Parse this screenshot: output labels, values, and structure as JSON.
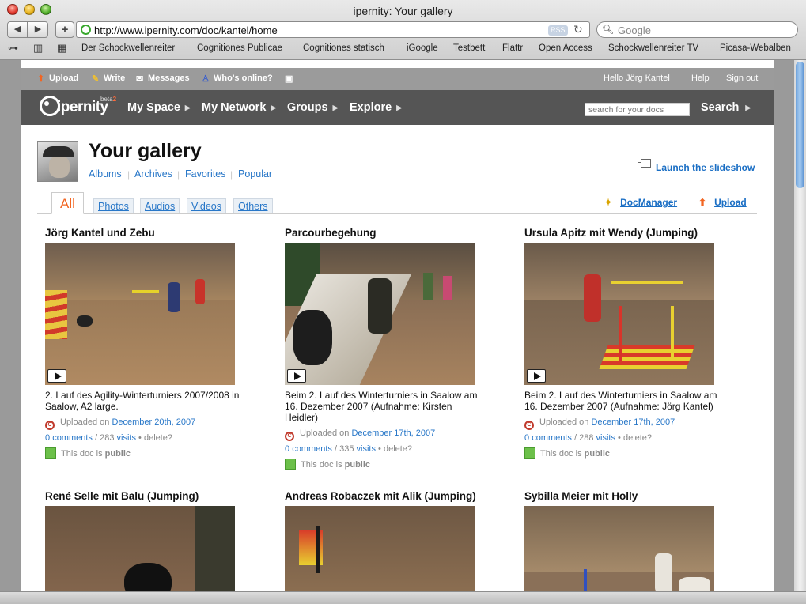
{
  "browser": {
    "window_title": "ipernity: Your gallery",
    "url": "http://www.ipernity.com/doc/kantel/home",
    "rss_label": "RSS",
    "search_placeholder": "Google",
    "bookmarks": [
      "Der Schockwellenreiter",
      "Cognitiones Publicae",
      "Cognitiones statisch",
      "iGoogle",
      "Testbett",
      "Flattr",
      "Open Access",
      "Schockwellenreiter TV",
      "Picasa-Webalben"
    ]
  },
  "topbar": {
    "upload": "Upload",
    "write": "Write",
    "messages": "Messages",
    "whos_online": "Who's online?",
    "hello": "Hello Jörg Kantel",
    "help": "Help",
    "sep": "|",
    "signout": "Sign out"
  },
  "nav": {
    "logo": "ipernity",
    "beta": "beta",
    "beta_num": "2",
    "items": [
      "My Space",
      "My Network",
      "Groups",
      "Explore"
    ],
    "search_placeholder": "search for your docs",
    "search_button": "Search"
  },
  "gallery": {
    "title": "Your gallery",
    "sublinks": [
      "Albums",
      "Archives",
      "Favorites",
      "Popular"
    ],
    "sublink_sep": "|",
    "slideshow": "Launch the slideshow",
    "tabs": [
      "All",
      "Photos",
      "Audios",
      "Videos",
      "Others"
    ],
    "docmanager": "DocManager",
    "upload": "Upload"
  },
  "labels": {
    "uploaded_on": "Uploaded on",
    "comments": "comments",
    "visits": "visits",
    "delete": "delete?",
    "this_doc_is": "This doc is",
    "public": "public"
  },
  "docs": [
    {
      "title": "Jörg Kantel und Zebu",
      "desc": "2. Lauf des Agility-Winterturniers 2007/2008 in Saalow, A2 large.",
      "date": "December 20th, 2007",
      "comments": "0",
      "visits": "283"
    },
    {
      "title": "Parcourbegehung",
      "desc": "Beim 2. Lauf des Winterturniers in Saalow am 16. Dezember 2007 (Aufnahme: Kirsten Heidler)",
      "date": "December 17th, 2007",
      "comments": "0",
      "visits": "335"
    },
    {
      "title": "Ursula Apitz mit Wendy (Jumping)",
      "desc": "Beim 2. Lauf des Winterturniers in Saalow am 16. Dezember 2007 (Aufnahme: Jörg Kantel)",
      "date": "December 17th, 2007",
      "comments": "0",
      "visits": "288"
    },
    {
      "title": "René Selle mit Balu (Jumping)"
    },
    {
      "title": "Andreas Robaczek mit Alik (Jumping)"
    },
    {
      "title": "Sybilla Meier mit Holly"
    }
  ],
  "colors": {
    "link": "#2877c8",
    "tab_active": "#f26522",
    "topbar": "#9b9b9b",
    "navbar": "#555555",
    "public_icon": "#6cc04a"
  }
}
